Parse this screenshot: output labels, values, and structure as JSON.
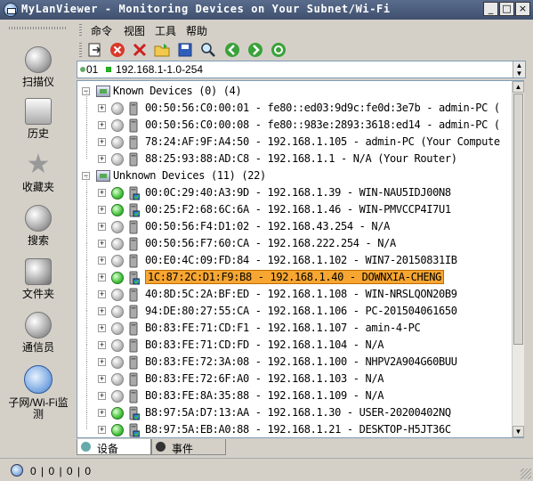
{
  "window": {
    "title": "MyLanViewer - Monitoring Devices on Your Subnet/Wi-Fi",
    "controls": [
      "_",
      "□",
      "×"
    ]
  },
  "sidebar": {
    "items": [
      {
        "label": "扫描仪",
        "icon": "scanner-icon"
      },
      {
        "label": "历史",
        "icon": "history-icon"
      },
      {
        "label": "收藏夹",
        "icon": "favorites-star-icon"
      },
      {
        "label": "搜索",
        "icon": "search-icon"
      },
      {
        "label": "文件夹",
        "icon": "folder-icon"
      },
      {
        "label": "通信员",
        "icon": "messenger-icon"
      },
      {
        "label": "子网/Wi-Fi监测",
        "icon": "subnet-monitor-icon"
      }
    ]
  },
  "menu": [
    "命令",
    "视图",
    "工具",
    "帮助"
  ],
  "toolbar": {
    "buttons": [
      "import-icon",
      "stop-icon",
      "delete-icon",
      "open-folder-icon",
      "save-icon",
      "search-icon",
      "back-icon",
      "forward-icon",
      "refresh-icon"
    ]
  },
  "address": {
    "part1": "01",
    "part2": "192.168.1-1.0-254"
  },
  "tree": {
    "groups": [
      {
        "label": "Known Devices (0) (4)",
        "rows": [
          {
            "text": "00:50:56:C0:00:01 - fe80::ed03:9d9c:fe0d:3e7b - admin-PC (",
            "online": false
          },
          {
            "text": "00:50:56:C0:00:08 - fe80::983e:2893:3618:ed14 - admin-PC (",
            "online": false
          },
          {
            "text": "78:24:AF:9F:A4:50 - 192.168.1.105 - admin-PC (Your Compute",
            "online": false
          },
          {
            "text": "88:25:93:88:AD:C8 - 192.168.1.1 - N/A (Your Router)",
            "online": false
          }
        ]
      },
      {
        "label": "Unknown Devices (11) (22)",
        "rows": [
          {
            "text": "00:0C:29:40:A3:9D - 192.168.1.39 - WIN-NAU5IDJ00N8",
            "online": true
          },
          {
            "text": "00:25:F2:68:6C:6A - 192.168.1.46 - WIN-PMVCCP4I7U1",
            "online": true
          },
          {
            "text": "00:50:56:F4:D1:02 - 192.168.43.254 - N/A",
            "online": false
          },
          {
            "text": "00:50:56:F7:60:CA - 192.168.222.254 - N/A",
            "online": false
          },
          {
            "text": "00:E0:4C:09:FD:84 - 192.168.1.102 - WIN7-20150831IB",
            "online": false
          },
          {
            "text": "1C:87:2C:D1:F9:B8 - 192.168.1.40 - DOWNXIA-CHENG",
            "online": true,
            "selected": true
          },
          {
            "text": "40:8D:5C:2A:BF:ED - 192.168.1.108 - WIN-NRSLQON20B9",
            "online": false
          },
          {
            "text": "94:DE:80:27:55:CA - 192.168.1.106 - PC-201504061650",
            "online": false
          },
          {
            "text": "B0:83:FE:71:CD:F1 - 192.168.1.107 - amin-4-PC",
            "online": false
          },
          {
            "text": "B0:83:FE:71:CD:FD - 192.168.1.104 - N/A",
            "online": false
          },
          {
            "text": "B0:83:FE:72:3A:08 - 192.168.1.100 - NHPV2A904G60BUU",
            "online": false
          },
          {
            "text": "B0:83:FE:72:6F:A0 - 192.168.1.103 - N/A",
            "online": false
          },
          {
            "text": "B0:83:FE:8A:35:88 - 192.168.1.109 - N/A",
            "online": false
          },
          {
            "text": "B8:97:5A:D7:13:AA - 192.168.1.30 - USER-20200402NQ",
            "online": true
          },
          {
            "text": "B8:97:5A:EB:A0:88 - 192.168.1.21 - DESKTOP-H5JT36C",
            "online": true
          }
        ]
      }
    ]
  },
  "tabs": [
    {
      "label": "设备",
      "icon": "devices-icon"
    },
    {
      "label": "事件",
      "icon": "events-icon"
    }
  ],
  "status": {
    "text": "0 | 0 | 0 | 0"
  },
  "colors": {
    "selected_bg": "#f7a631",
    "online": "#43c33a",
    "titlebar": "#4a5b7a"
  }
}
